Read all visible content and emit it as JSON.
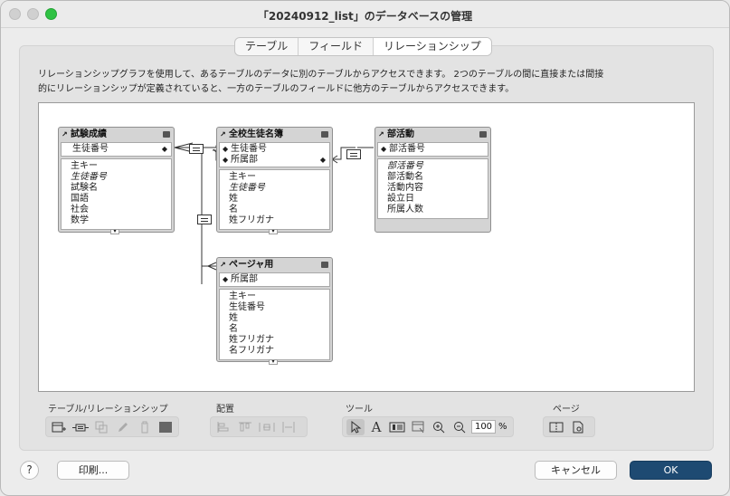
{
  "window": {
    "title": "「20240912_list」のデータベースの管理"
  },
  "tabs": [
    {
      "label": "テーブル",
      "active": false
    },
    {
      "label": "フィールド",
      "active": false
    },
    {
      "label": "リレーションシップ",
      "active": true
    }
  ],
  "description": {
    "line1": "リレーションシップグラフを使用して、あるテーブルのデータに別のテーブルからアクセスできます。 2つのテーブルの間に直接または間接",
    "line2": "的にリレーションシップが定義されていると、一方のテーブルのフィールドに他方のテーブルからアクセスできます。"
  },
  "tables": {
    "shiken": {
      "name": "試験成績",
      "keys": [
        "生徒番号"
      ],
      "fields": [
        "主キー",
        "生徒番号",
        "試験名",
        "国語",
        "社会",
        "数学"
      ]
    },
    "zenkou": {
      "name": "全校生徒名簿",
      "keys": [
        "生徒番号",
        "所属部"
      ],
      "fields": [
        "主キー",
        "生徒番号",
        "姓",
        "名",
        "姓フリガナ"
      ]
    },
    "bukatsu": {
      "name": "部活動",
      "keys": [
        "部活番号"
      ],
      "fields": [
        "部活番号",
        "部活動名",
        "活動内容",
        "設立日",
        "所属人数"
      ]
    },
    "pager": {
      "name": "ページャ用",
      "keys": [
        "所属部"
      ],
      "fields": [
        "主キー",
        "生徒番号",
        "姓",
        "名",
        "姓フリガナ",
        "名フリガナ"
      ]
    }
  },
  "toolbar": {
    "groups": {
      "tables": "テーブル/リレーションシップ",
      "arrange": "配置",
      "tools": "ツール",
      "page": "ページ"
    },
    "zoom_value": "100",
    "zoom_unit": "%"
  },
  "buttons": {
    "help": "?",
    "print": "印刷...",
    "cancel": "キャンセル",
    "ok": "OK"
  }
}
